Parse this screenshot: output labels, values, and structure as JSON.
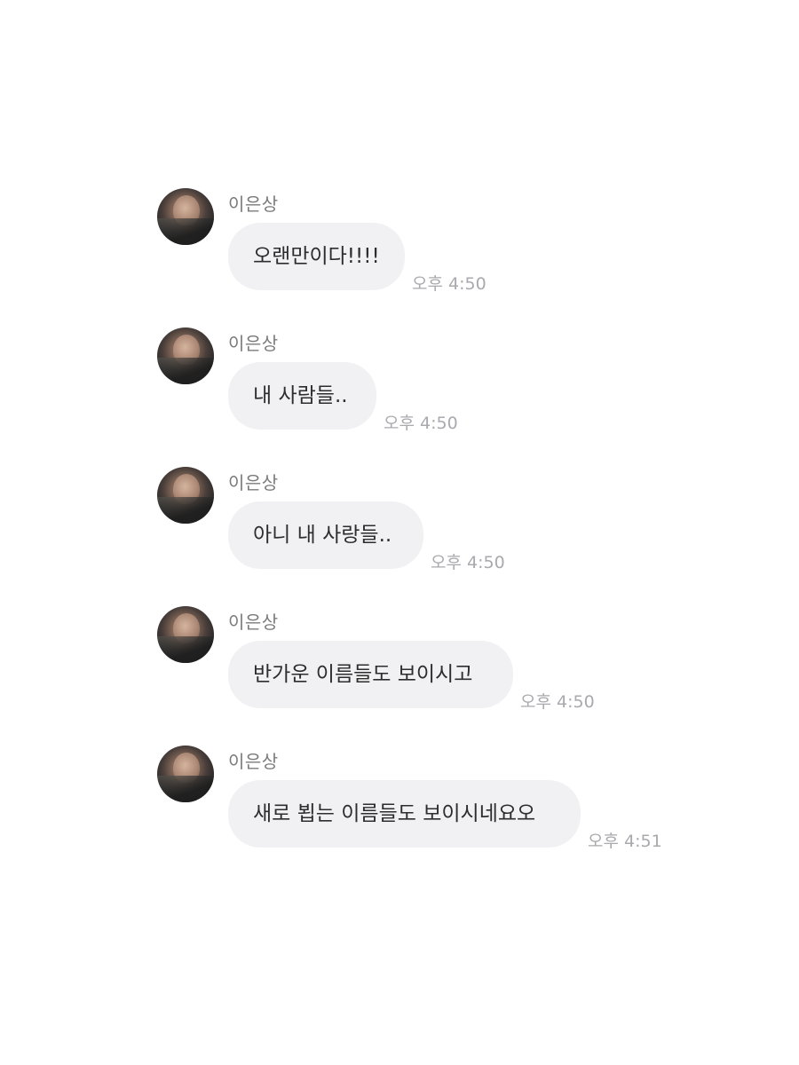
{
  "messages": [
    {
      "sender": "이은상",
      "text": "오랜만이다!!!!",
      "time": "오후 4:50"
    },
    {
      "sender": "이은상",
      "text": "내 사람들..",
      "time": "오후 4:50"
    },
    {
      "sender": "이은상",
      "text": "아니 내 사랑들..",
      "time": "오후 4:50"
    },
    {
      "sender": "이은상",
      "text": "반가운 이름들도 보이시고",
      "time": "오후 4:50"
    },
    {
      "sender": "이은상",
      "text": "새로 뵙는 이름들도 보이시네요오",
      "time": "오후 4:51"
    }
  ],
  "colors": {
    "bubble": "#f1f1f3",
    "text": "#2d2d2d",
    "sender": "#7b7b7b",
    "time": "#a9a9ae"
  },
  "icons": {
    "avatar": "profile-photo"
  }
}
